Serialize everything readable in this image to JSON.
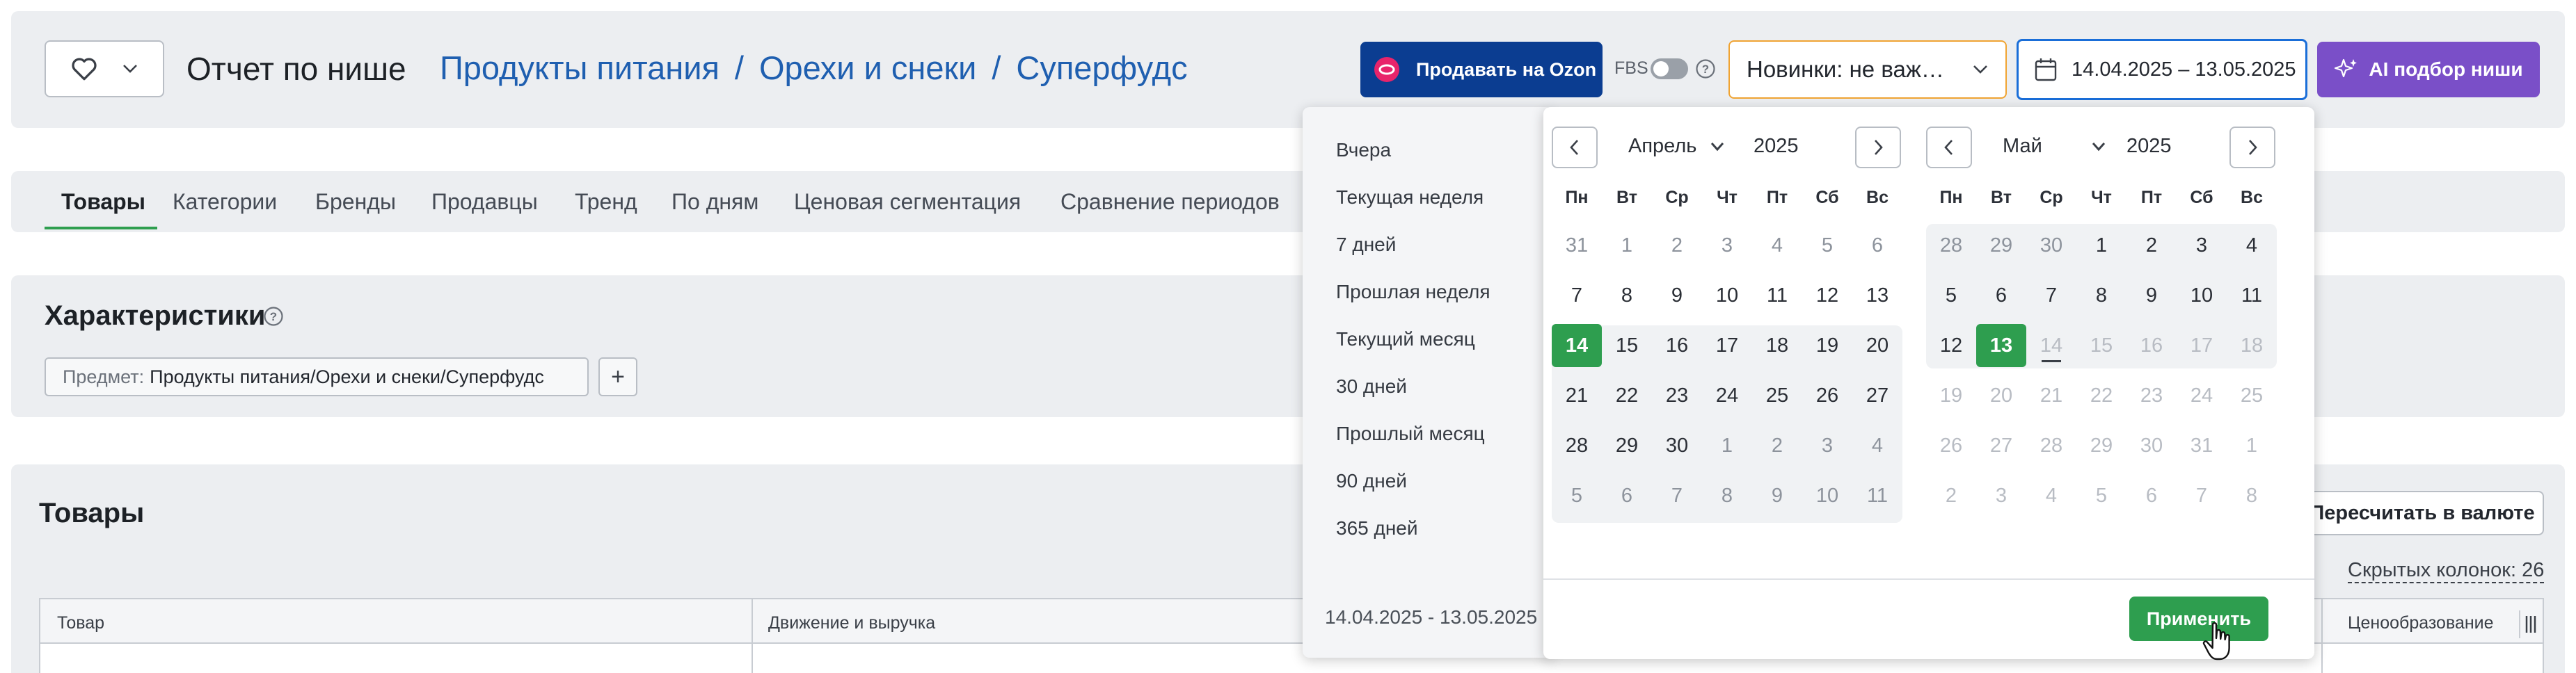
{
  "header": {
    "favorite_icon": "heart-icon",
    "dropdown_icon": "chevron-down-icon",
    "title": "Отчет по нише",
    "breadcrumb": [
      "Продукты питания",
      "Орехи и снеки",
      "Суперфудс"
    ],
    "breadcrumb_sep": "/",
    "ozon_button": "Продавать на Ozon",
    "fbs_label": "FBS",
    "novelties_select": "Новинки: не важ…",
    "date_range": "14.04.2025 – 13.05.2025",
    "ai_button": "AI подбор ниши"
  },
  "tabs": [
    "Товары",
    "Категории",
    "Бренды",
    "Продавцы",
    "Тренд",
    "По дням",
    "Ценовая сегментация",
    "Сравнение периодов"
  ],
  "characteristics": {
    "title": "Характеристики",
    "chip_label": "Предмет:",
    "chip_value": "Продукты питания/Орехи и снеки/Суперфудс",
    "add_label": "+"
  },
  "products": {
    "title": "Товары",
    "recalc_button": "Пересчитать в валюте",
    "hidden_columns": "Скрытых колонок: 26",
    "columns": [
      "Товар",
      "Движение и выручка",
      "Ценообразование"
    ]
  },
  "datepicker": {
    "presets": [
      "Вчера",
      "Текущая неделя",
      "7 дней",
      "Прошлая неделя",
      "Текущий месяц",
      "30 дней",
      "Прошлый месяц",
      "90 дней",
      "365 дней"
    ],
    "range_text": "14.04.2025 - 13.05.2025",
    "apply_button": "Применить",
    "weekdays": [
      "Пн",
      "Вт",
      "Ср",
      "Чт",
      "Пт",
      "Сб",
      "Вс"
    ],
    "left": {
      "month": "Апрель",
      "year": "2025",
      "weeks": [
        [
          "31",
          "1",
          "2",
          "3",
          "4",
          "5",
          "6"
        ],
        [
          "7",
          "8",
          "9",
          "10",
          "11",
          "12",
          "13"
        ],
        [
          "14",
          "15",
          "16",
          "17",
          "18",
          "19",
          "20"
        ],
        [
          "21",
          "22",
          "23",
          "24",
          "25",
          "26",
          "27"
        ],
        [
          "28",
          "29",
          "30",
          "1",
          "2",
          "3",
          "4"
        ],
        [
          "5",
          "6",
          "7",
          "8",
          "9",
          "10",
          "11"
        ]
      ]
    },
    "right": {
      "month": "Май",
      "year": "2025",
      "weeks": [
        [
          "28",
          "29",
          "30",
          "1",
          "2",
          "3",
          "4"
        ],
        [
          "5",
          "6",
          "7",
          "8",
          "9",
          "10",
          "11"
        ],
        [
          "12",
          "13",
          "14",
          "15",
          "16",
          "17",
          "18"
        ],
        [
          "19",
          "20",
          "21",
          "22",
          "23",
          "24",
          "25"
        ],
        [
          "26",
          "27",
          "28",
          "29",
          "30",
          "31",
          "1"
        ],
        [
          "2",
          "3",
          "4",
          "5",
          "6",
          "7",
          "8"
        ]
      ]
    }
  },
  "colors": {
    "accent_blue": "#1f5fb0",
    "ozon_blue": "#0b3d91",
    "ai_purple": "#7a4fc8",
    "selected_green": "#2e9e4f",
    "novelties_border": "#f0a433",
    "date_border": "#1a6ed8"
  }
}
